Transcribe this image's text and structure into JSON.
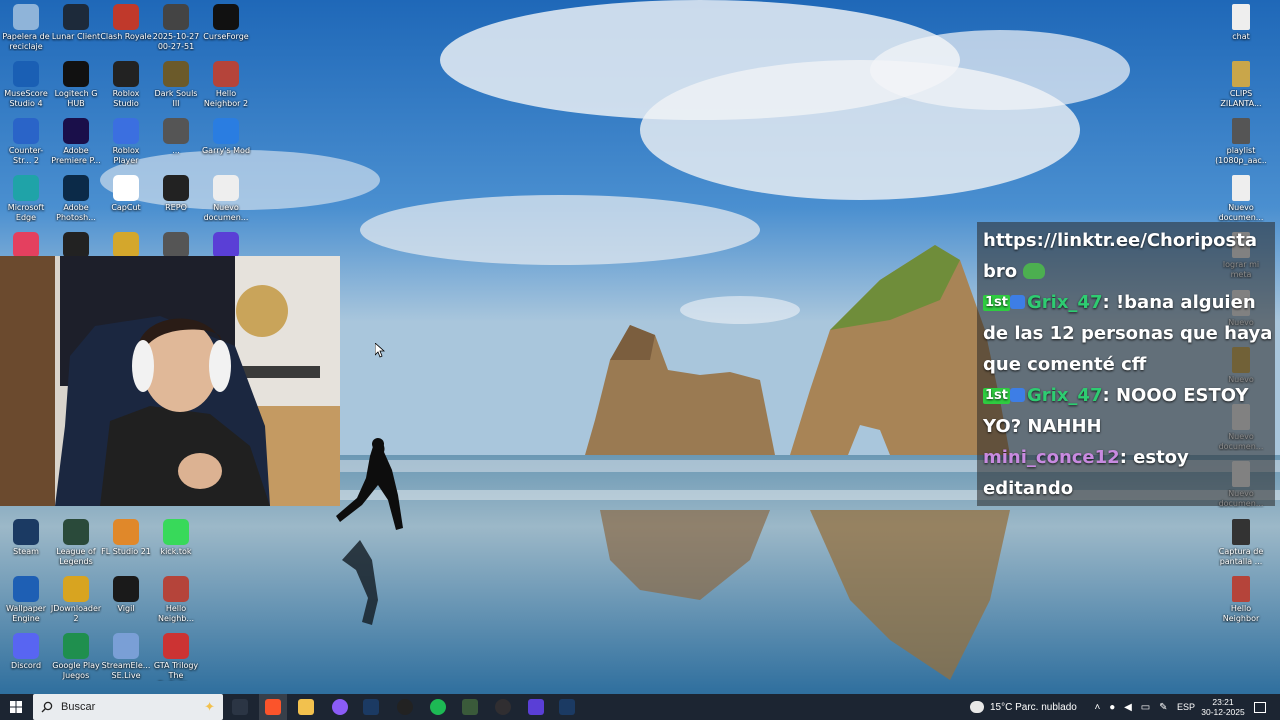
{
  "desktop": {
    "icons_left": [
      {
        "label": "Papelera de reciclaje",
        "icon": "recycle-bin-icon",
        "color": "#8fb4d9"
      },
      {
        "label": "Lunar Client",
        "icon": "lunar-client-icon",
        "color": "#1d2a3a"
      },
      {
        "label": "Clash Royale",
        "icon": "clash-royale-icon",
        "color": "#c0392b"
      },
      {
        "label": "2025-10-27 00-27-51",
        "icon": "video-file-icon",
        "color": "#444444"
      },
      {
        "label": "CurseForge",
        "icon": "curseforge-icon",
        "color": "#111111"
      },
      {
        "label": "MuseScore Studio 4",
        "icon": "musescore-icon",
        "color": "#1a5fb4"
      },
      {
        "label": "Logitech G HUB",
        "icon": "logitech-icon",
        "color": "#111111"
      },
      {
        "label": "Roblox Studio",
        "icon": "roblox-studio-icon",
        "color": "#222222"
      },
      {
        "label": "Dark Souls III",
        "icon": "dark-souls-icon",
        "color": "#6b5a2a"
      },
      {
        "label": "Hello Neighbor 2",
        "icon": "hello-neighbor-icon",
        "color": "#b5443a"
      },
      {
        "label": "Counter-Str... 2",
        "icon": "counter-strike-icon",
        "color": "#2a64c8"
      },
      {
        "label": "Adobe Premiere P...",
        "icon": "premiere-icon",
        "color": "#1a0f4a"
      },
      {
        "label": "Roblox Player",
        "icon": "roblox-player-icon",
        "color": "#3b6fe0"
      },
      {
        "label": "...",
        "icon": "video-file-icon",
        "color": "#555555"
      },
      {
        "label": "Garry's Mod",
        "icon": "garrys-mod-icon",
        "color": "#2a7de1"
      },
      {
        "label": "Microsoft Edge",
        "icon": "edge-icon",
        "color": "#1fa3a8"
      },
      {
        "label": "Adobe Photosh...",
        "icon": "photoshop-icon",
        "color": "#0b2a48"
      },
      {
        "label": "CapCut",
        "icon": "capcut-icon",
        "color": "#ffffff"
      },
      {
        "label": "REPO",
        "icon": "repo-icon",
        "color": "#222222"
      },
      {
        "label": "Nuevo documen...",
        "icon": "document-icon",
        "color": "#eeeeee"
      },
      {
        "label": "",
        "icon": "tiktok-icon",
        "color": "#e4405f"
      },
      {
        "label": "",
        "icon": "epic-games-icon",
        "color": "#222222"
      },
      {
        "label": "",
        "icon": "duck-icon",
        "color": "#d4a72c"
      },
      {
        "label": "",
        "icon": "video-file-icon",
        "color": "#555555"
      },
      {
        "label": "",
        "icon": "grid-app-icon",
        "color": "#5a3fd6"
      },
      {
        "label": "Steam",
        "icon": "steam-icon",
        "color": "#1b3a63"
      },
      {
        "label": "League of Legends",
        "icon": "league-icon",
        "color": "#2a4a3a"
      },
      {
        "label": "FL Studio 21",
        "icon": "fl-studio-icon",
        "color": "#e0882a"
      },
      {
        "label": "kick.tok",
        "icon": "kick-icon",
        "color": "#38d95a"
      },
      {
        "label": "Wallpaper Engine",
        "icon": "wallpaper-engine-icon",
        "color": "#1e5fb4"
      },
      {
        "label": "JDownloader 2",
        "icon": "jdownloader-icon",
        "color": "#d8a420"
      },
      {
        "label": "Vigil",
        "icon": "vigil-icon",
        "color": "#1a1a1a"
      },
      {
        "label": "Hello Neighb...",
        "icon": "hello-neighbor-icon",
        "color": "#b5443a"
      },
      {
        "label": "Discord",
        "icon": "discord-icon",
        "color": "#5865f2"
      },
      {
        "label": "Google Play Juegos",
        "icon": "google-play-games-icon",
        "color": "#1f8f4e"
      },
      {
        "label": "StreamEle... SE.Live",
        "icon": "streamelements-icon",
        "color": "#7a9fd6"
      },
      {
        "label": "GTA Trilogy The Definiti...",
        "icon": "gta-icon",
        "color": "#cc3333"
      }
    ],
    "icons_right": [
      {
        "label": "chat",
        "icon": "document-icon",
        "color": "#eeeeee"
      },
      {
        "label": "CLIPS ZILANTA...",
        "icon": "folder-image-icon",
        "color": "#c9a64a"
      },
      {
        "label": "playlist (1080p_aac...",
        "icon": "video-file-icon",
        "color": "#555555"
      },
      {
        "label": "Nuevo documen...",
        "icon": "document-icon",
        "color": "#eeeeee"
      },
      {
        "label": "lograr mi meta",
        "icon": "document-icon",
        "color": "#eeeeee"
      },
      {
        "label": "Nuevo",
        "icon": "document-icon",
        "color": "#eeeeee"
      },
      {
        "label": "Nuevo",
        "icon": "folder-image-icon",
        "color": "#c9a64a"
      },
      {
        "label": "Nuevo documen...",
        "icon": "document-icon",
        "color": "#eeeeee"
      },
      {
        "label": "Nuevo documen...",
        "icon": "document-icon",
        "color": "#eeeeee"
      },
      {
        "label": "Captura de pantalla ...",
        "icon": "image-file-icon",
        "color": "#333333"
      },
      {
        "label": "Hello Neighbor",
        "icon": "hello-neighbor-icon",
        "color": "#b5443a"
      }
    ]
  },
  "chat_overlay": {
    "link_text": "https://linktr.ee/Choriposta bro",
    "messages": [
      {
        "badge": "1st",
        "user": "Grix_47",
        "user_color": "#2ecc71",
        "text": "!bana alguien de las 12 personas que haya que comenté cff"
      },
      {
        "badge": "1st",
        "user": "Grix_47",
        "user_color": "#2ecc71",
        "text": "NOOO ESTOY YO? NAHHH"
      },
      {
        "badge": "",
        "user": "mini_conce12",
        "user_color": "#c88ae0",
        "text": "estoy editando"
      }
    ]
  },
  "taskbar": {
    "search_placeholder": "Buscar",
    "weather": "15°C Parc. nublado",
    "language": "ESP",
    "time": "23:21",
    "date": "30-12-2025",
    "apps": [
      {
        "icon": "task-view-icon",
        "color": "#2b3544"
      },
      {
        "icon": "brave-icon",
        "color": "#fb542b"
      },
      {
        "icon": "file-explorer-icon",
        "color": "#f2c14e"
      },
      {
        "icon": "messenger-icon",
        "color": "#8b5cf6"
      },
      {
        "icon": "steam-icon",
        "color": "#1b3a63"
      },
      {
        "icon": "obs-icon",
        "color": "#222222"
      },
      {
        "icon": "spotify-icon",
        "color": "#1db954"
      },
      {
        "icon": "battery-app-icon",
        "color": "#3a5a3a"
      },
      {
        "icon": "obs-studio-icon",
        "color": "#302e31"
      },
      {
        "icon": "grid-app-icon",
        "color": "#5a3fd6"
      },
      {
        "icon": "steam-icon",
        "color": "#1b3a63"
      }
    ]
  }
}
